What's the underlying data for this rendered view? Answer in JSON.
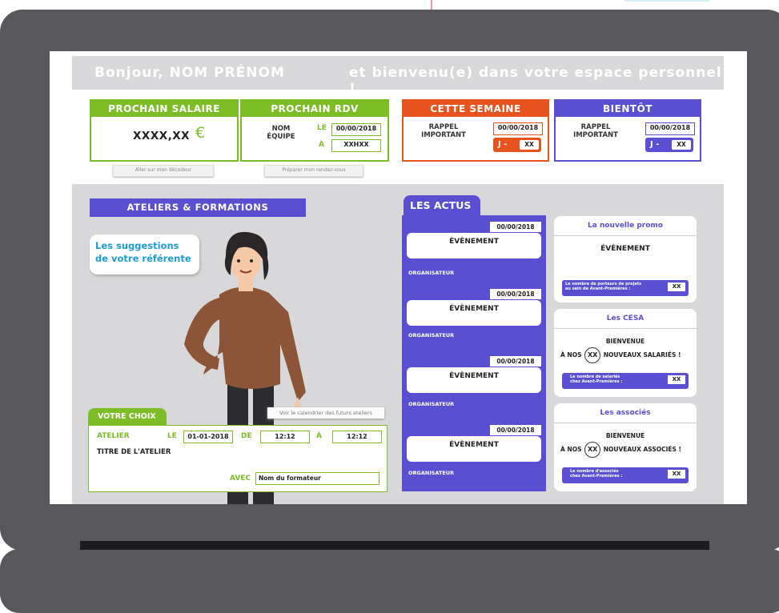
{
  "greeting": {
    "hello": "Bonjour,  NOM PRÉNOM",
    "welcome": "et bienvenu(e) dans votre espace personnel !"
  },
  "cards": {
    "salaire": {
      "title": "PROCHAIN SALAIRE",
      "amount": "XXXX,XX",
      "currency": "€",
      "button": "Aller sur mon décodeur",
      "color": "#7cbd26"
    },
    "rdv": {
      "title": "PROCHAIN RDV",
      "nom": "NOM",
      "equipe": "ÉQUIPE",
      "le": "LE",
      "date": "00/00/2018",
      "a": "À",
      "heure": "XXHXX",
      "button": "Préparer mon rendez-vous",
      "color": "#7cbd26"
    },
    "semaine": {
      "title": "CETTE SEMAINE",
      "rappel": "RAPPEL",
      "important": "IMPORTANT",
      "date": "00/00/2018",
      "j": "J -",
      "jval": "XX",
      "color": "#e6531f"
    },
    "bientot": {
      "title": "BIENTÔT",
      "rappel": "RAPPEL",
      "important": "IMPORTANT",
      "date": "00/00/2018",
      "j": "J -",
      "jval": "XX",
      "color": "#5b4fd1"
    }
  },
  "ateliers": {
    "title": "ATELIERS & FORMATIONS",
    "bubble_line1": "Les suggestions",
    "bubble_line2": "de votre référente",
    "calendar_button": "Voir le calendrier des futurs ateliers",
    "choice": {
      "tab": "VOTRE CHOIX",
      "atelier": "ATELIER",
      "le": "LE",
      "date": "01-01-2018",
      "de": "DE",
      "start": "12:12",
      "a": "À",
      "end": "12:12",
      "titre": "TITRE DE L'ATELIER",
      "avec": "AVEC",
      "formateur": "Nom du formateur"
    }
  },
  "actus": {
    "title": "LES ACTUS",
    "items": [
      {
        "date": "00/00/2018",
        "event": "ÉVÈNEMENT",
        "organizer": "ORGANISATEUR"
      },
      {
        "date": "00/00/2018",
        "event": "ÉVÈNEMENT",
        "organizer": "ORGANISATEUR"
      },
      {
        "date": "00/00/2018",
        "event": "ÉVÈNEMENT",
        "organizer": "ORGANISATEUR"
      },
      {
        "date": "00/00/2018",
        "event": "ÉVÈNEMENT",
        "organizer": "ORGANISATEUR"
      }
    ]
  },
  "right": {
    "promo": {
      "title": "La nouvelle promo",
      "event": "ÉVÈNEMENT",
      "pill_line1": "Le nombre de porteurs de projets",
      "pill_line2": "au sein de Avant-Premières :",
      "value": "XX"
    },
    "cesa": {
      "title": "Les CESA",
      "bienvenue": "BIENVENUE",
      "pre": "À NOS",
      "xx": "XX",
      "post": "NOUVEAUX SALARIÉS !",
      "pill_line1": "Le nombre de salariés",
      "pill_line2": "chez Avant-Premières :",
      "value": "XX"
    },
    "associes": {
      "title": "Les associés",
      "bienvenue": "BIENVENUE",
      "pre": "À NOS",
      "xx": "XX",
      "post": "NOUVEAUX ASSOCIÉS !",
      "pill_line1": "Le nombre d'associés",
      "pill_line2": "chez Avant-Premières :",
      "value": "XX"
    }
  }
}
